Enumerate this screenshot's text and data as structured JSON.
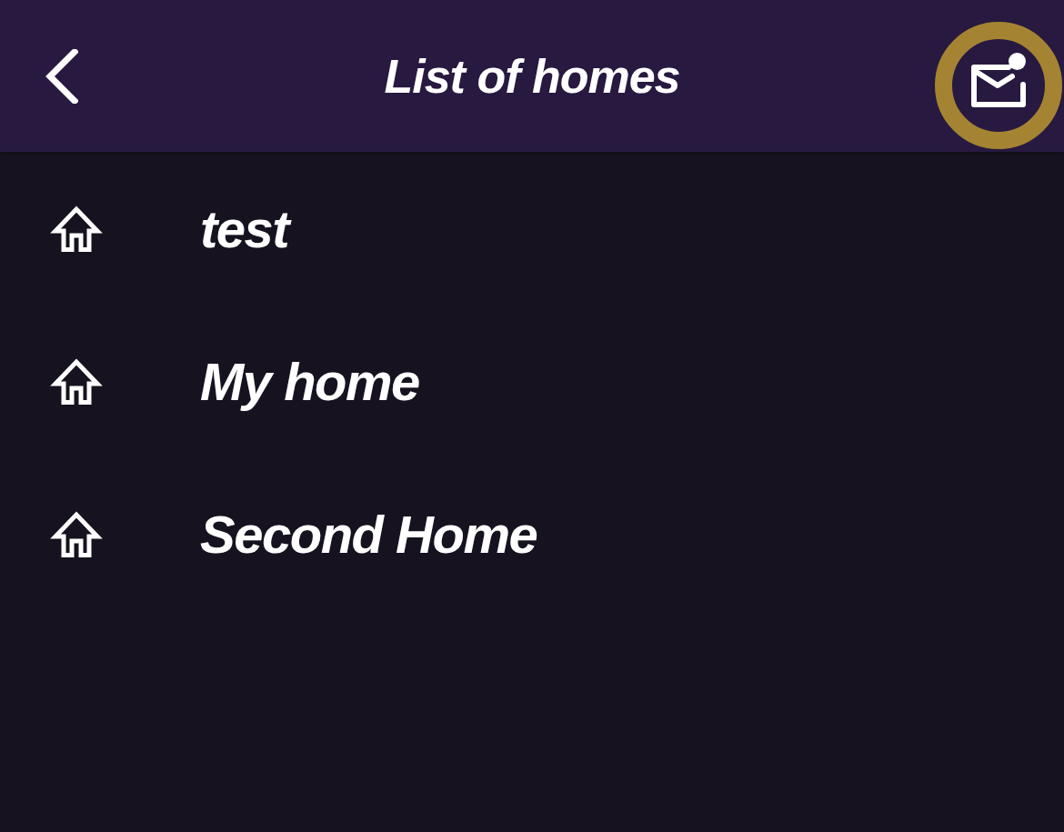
{
  "header": {
    "title": "List of homes",
    "mail_button": {
      "unread": true,
      "highlighted": true
    }
  },
  "homes": [
    {
      "name": "test"
    },
    {
      "name": "My home"
    },
    {
      "name": "Second Home"
    }
  ]
}
